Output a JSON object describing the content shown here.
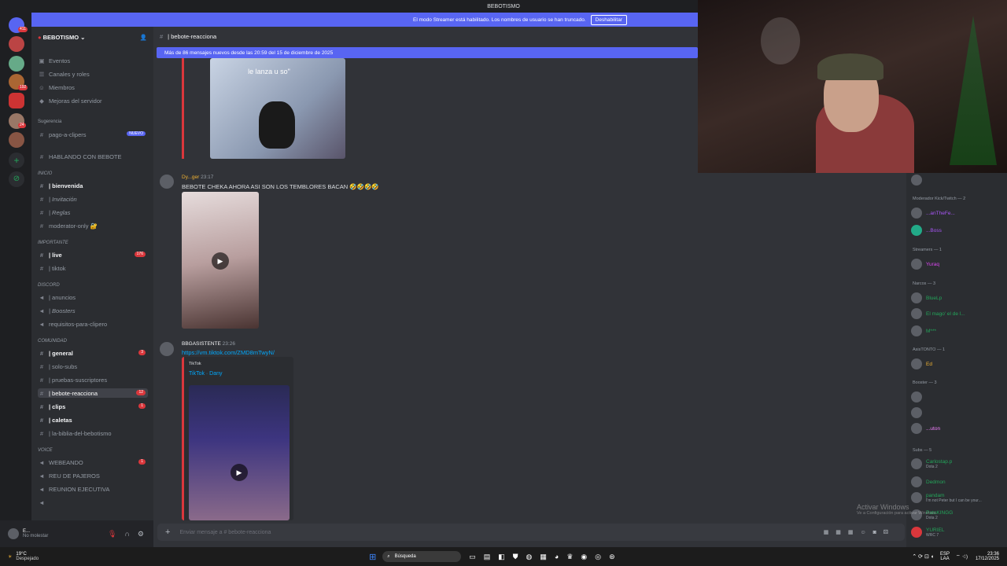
{
  "window": {
    "title": "BEBOTISMO"
  },
  "guilds": {
    "badges": [
      "411",
      "1",
      "192",
      "24"
    ]
  },
  "streamer_bar": {
    "text": "El modo Streamer está habilitado. Los nombres de usuario se han truncado.",
    "button": "Deshabilitar"
  },
  "server": {
    "name": "BEBOTISMO"
  },
  "sidebar": {
    "top": [
      "Eventos",
      "Canales y roles",
      "Miembros",
      "Mejoras del servidor"
    ],
    "suggestion_label": "Sugerencia",
    "suggestion_channel": "pago-a-clipers",
    "new_badge": "NUEVO",
    "talk": "HABLANDO CON BEBOTE",
    "cat_inicio": "INICIO",
    "inicio": [
      "| bienvenida",
      "| Invitación",
      "| Reglas",
      "moderator-only 🔐"
    ],
    "cat_importante": "IMPORTANTE",
    "importante": [
      "| live",
      "| tiktok"
    ],
    "live_badge": "176",
    "cat_discord": "DISCORD",
    "discord": [
      "| anuncios",
      "| Boosters",
      "requisitos-para-clipero"
    ],
    "cat_comunidad": "COMUNIDAD",
    "comunidad": [
      "| general",
      "| solo-subs",
      "| pruebas-suscriptores",
      "| bebote-reacciona",
      "| clips",
      "| caletas",
      "| la-biblia-del-bebotismo"
    ],
    "comunidad_badges": {
      "general": "3",
      "bebote": "12",
      "clips": "1"
    },
    "cat_voice": "VOICE",
    "voice": [
      "WEBEANDO",
      "REU DE PAJEROS",
      "REUNION EJECUTIVA",
      ""
    ],
    "voice_badge": "1"
  },
  "user": {
    "name": "E...",
    "status": "No molestar"
  },
  "chat": {
    "channel": "| bebote-reacciona",
    "new_messages": "Más de 86 mensajes nuevos desde las 20:59 del 15 de diciembre de 2025",
    "clip_overlay": "le lanza u     so\"",
    "msg1_author": "Dy...ger",
    "msg1_time": "23:17",
    "msg1_text": "BEBOTE CHEKA AHORA ASI SON LOS TEMBLORES BACAN 🤣🤣🤣🤣",
    "msg2_author": "BBGASISTENTE",
    "msg2_time": "23:26",
    "msg2_link": "https://vm.tiktok.com/ZMD8mTwyN/",
    "embed_provider": "TikTok",
    "embed_title": "TikTok · Dany",
    "composer": "Enviar mensaje a #   bebote-reacciona"
  },
  "members": {
    "groups": [
      {
        "title": "Moderador Kick/Twitch — 2",
        "users": [
          "...anTheFe...",
          "...Boss"
        ]
      },
      {
        "title": "Streamers — 1",
        "users": [
          "Yuraq"
        ]
      },
      {
        "title": "Narcos — 3",
        "users": [
          "BlueLp",
          "El mago' el de l...",
          "M***"
        ]
      },
      {
        "title": "AsisTONTO — 1",
        "users": [
          "Ed"
        ]
      },
      {
        "title": "Booster — 3",
        "users": [
          "",
          "",
          "...uton"
        ]
      },
      {
        "title": "Subs — 5",
        "users": [
          "Carlostap.p",
          "Dedmon",
          "pandam",
          "PatoKINGG",
          "YURIEL"
        ]
      }
    ],
    "subtitles": [
      "Dota 2",
      "",
      "I'm not Peter but I can be your...",
      "Dota 2",
      "WRC 7"
    ]
  },
  "watermark": {
    "title": "Activar Windows",
    "sub": "Ve a Configuración para activar Windows."
  },
  "taskbar": {
    "weather": "19°C",
    "weather_sub": "Despejado",
    "search": "Búsqueda",
    "lang": "ESP",
    "lang2": "LAA",
    "time": "23:36",
    "date": "17/12/2025"
  },
  "colors": {
    "accent": "#5865f2",
    "bg": "#313338",
    "sidebar": "#2b2d31",
    "green": "#23a55a"
  }
}
